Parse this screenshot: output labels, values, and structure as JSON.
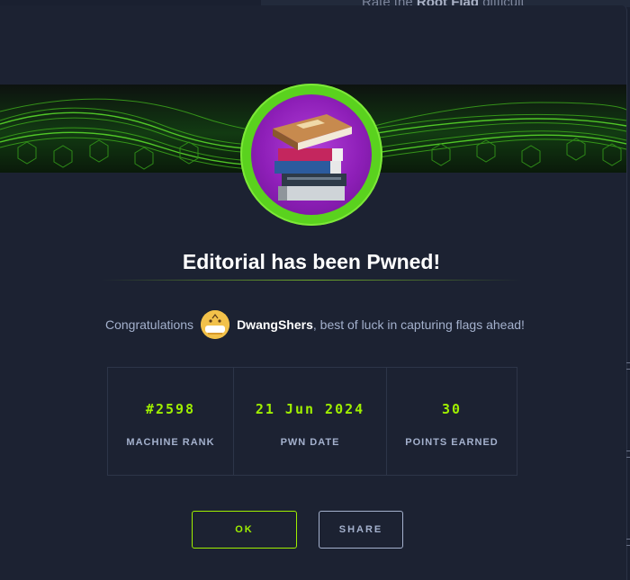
{
  "background": {
    "partial_text_plain": "Rate the",
    "partial_text_bold": "Root Flag",
    "partial_text_tail": "difficult"
  },
  "modal": {
    "title": "Editorial has been Pwned!",
    "congrats_prefix": "Congratulations",
    "username": "DwangShers",
    "congrats_suffix": ", best of luck in capturing flags ahead!",
    "stats": [
      {
        "value": "#2598",
        "label": "MACHINE RANK"
      },
      {
        "value": "21 Jun 2024",
        "label": "PWN DATE"
      },
      {
        "value": "30",
        "label": "POINTS EARNED"
      }
    ],
    "buttons": {
      "ok_label": "OK",
      "share_label": "SHARE"
    }
  },
  "colors": {
    "accent_green": "#9fef00",
    "background": "#1c2232",
    "text_muted": "#a4b1cd",
    "avatar_ring": "#5ad21e",
    "avatar_fill": "#9b2cc9"
  },
  "icons": {
    "machine_avatar": "book-stack-icon",
    "user_avatar": "smiley-cake-avatar"
  }
}
